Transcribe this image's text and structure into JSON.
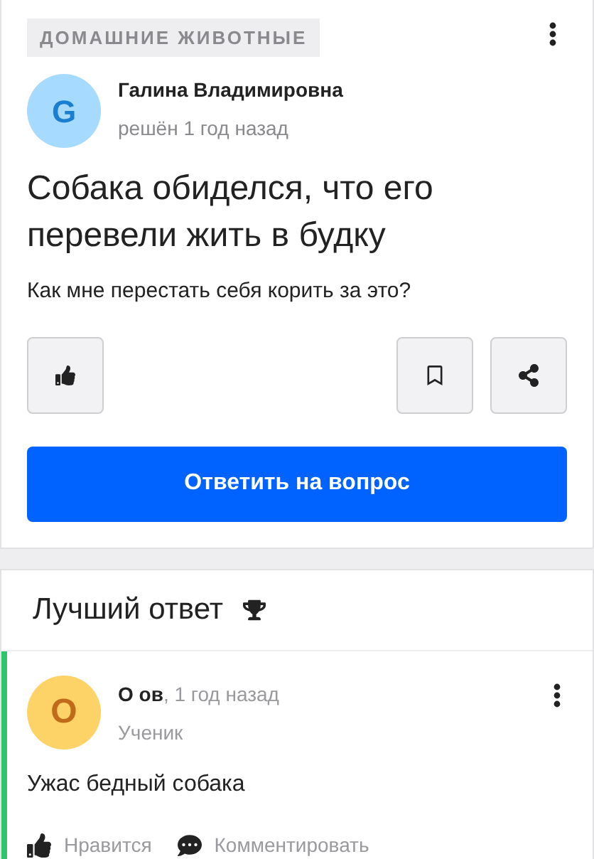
{
  "question": {
    "category": "ДОМАШНИЕ ЖИВОТНЫЕ",
    "author": {
      "initial": "G",
      "name": "Галина Владимировна",
      "meta": "решён 1 год назад"
    },
    "title": "Собака обиделся, что его перевели жить в будку",
    "body": "Как мне перестать себя корить за это?",
    "answer_button": "Ответить на вопрос"
  },
  "best_answer": {
    "heading": "Лучший ответ",
    "author": {
      "initial": "O",
      "name": "О ов",
      "time": ", 1 год назад",
      "rank": "Ученик"
    },
    "text": "Ужас бедный собака",
    "actions": [
      {
        "kind": "like",
        "label": "Нравится"
      },
      {
        "kind": "comment",
        "label": "Комментировать"
      }
    ]
  }
}
